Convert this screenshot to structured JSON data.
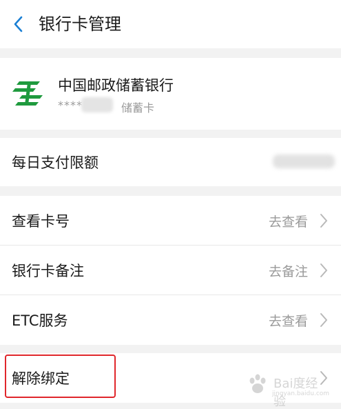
{
  "header": {
    "title": "银行卡管理"
  },
  "card": {
    "bank_name": "中国邮政储蓄银行",
    "mask": "****",
    "type": "储蓄卡",
    "brand_color": "#1f9a3e"
  },
  "limit": {
    "label": "每日支付限额"
  },
  "menu": [
    {
      "label": "查看卡号",
      "value": "去查看"
    },
    {
      "label": "银行卡备注",
      "value": "去备注"
    },
    {
      "label": "ETC服务",
      "value": "去查看"
    }
  ],
  "unbind": {
    "label": "解除绑定",
    "highlight_color": "#e0262b"
  },
  "watermark": {
    "text": "Bai度经验",
    "sub": "jingyan.baidu.com"
  },
  "colors": {
    "accent": "#1a7fd4",
    "text_secondary": "#9a9a9a",
    "background": "#f2f2f2"
  }
}
